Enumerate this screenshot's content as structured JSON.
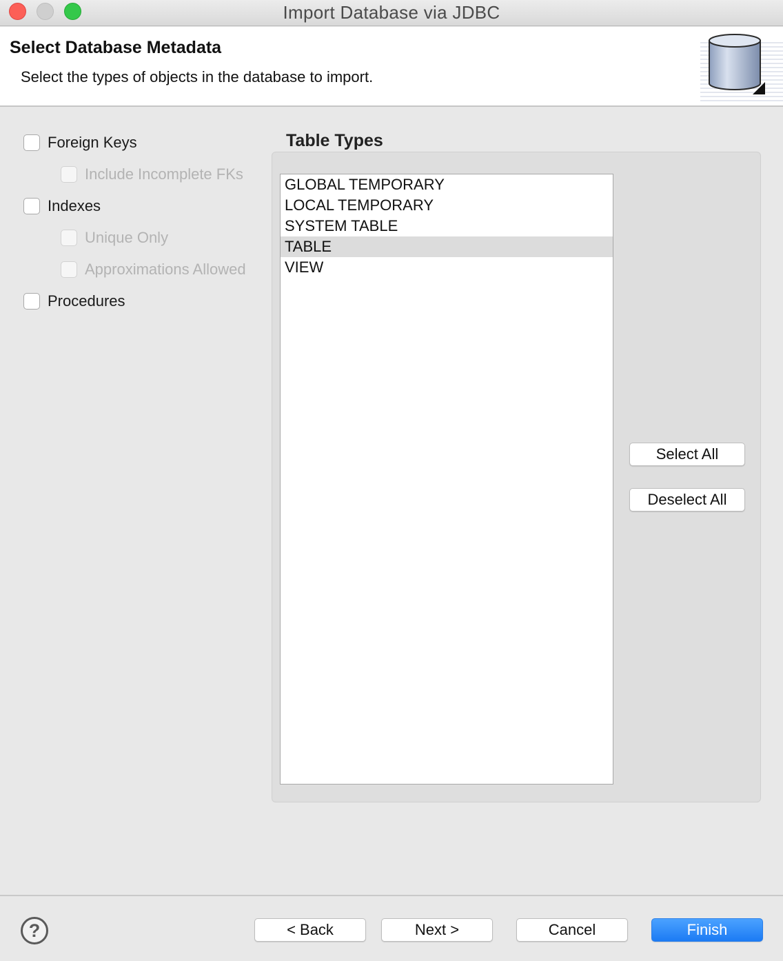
{
  "window": {
    "title": "Import Database via JDBC"
  },
  "banner": {
    "title": "Select Database Metadata",
    "description": "Select the types of objects in the database to import."
  },
  "options": {
    "foreign_keys": "Foreign Keys",
    "include_incomplete_fks": "Include Incomplete FKs",
    "indexes": "Indexes",
    "unique_only": "Unique Only",
    "approximations_allowed": "Approximations Allowed",
    "procedures": "Procedures"
  },
  "table_types": {
    "label": "Table Types",
    "items": [
      "GLOBAL TEMPORARY",
      "LOCAL TEMPORARY",
      "SYSTEM TABLE",
      "TABLE",
      "VIEW"
    ],
    "selected": "TABLE",
    "select_all": "Select All",
    "deselect_all": "Deselect All"
  },
  "footer": {
    "help": "?",
    "back": "< Back",
    "next": "Next >",
    "cancel": "Cancel",
    "finish": "Finish"
  },
  "icons": [
    "database-icon",
    "help-icon"
  ],
  "colors": {
    "primary_button": "#1c7bf4",
    "close": "#fc5f57",
    "maximize": "#34c84a"
  }
}
